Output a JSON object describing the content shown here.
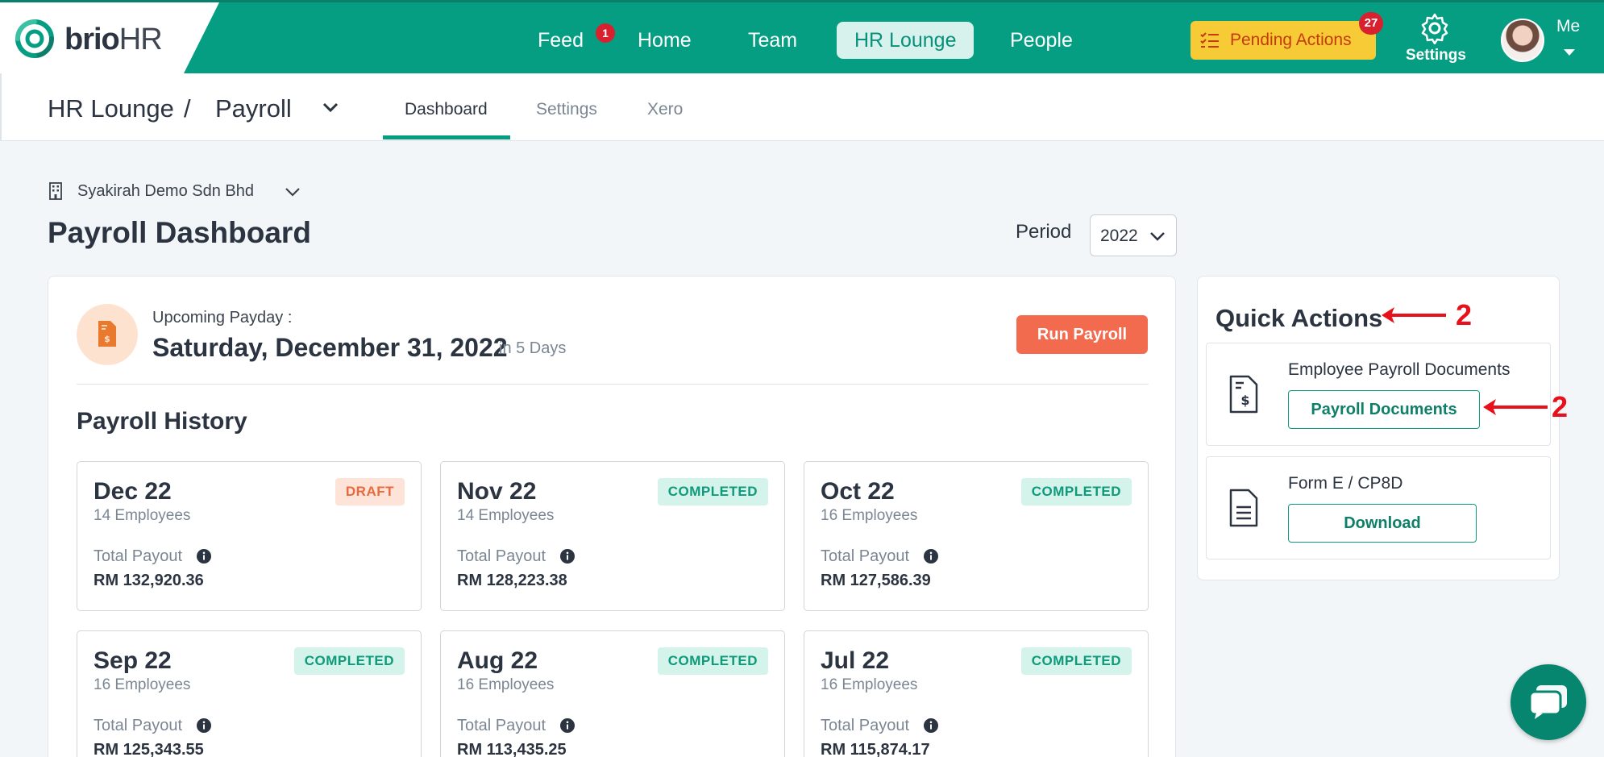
{
  "brand": {
    "name_bold": "brio",
    "name_light": "HR"
  },
  "nav": {
    "items": [
      {
        "label": "Feed",
        "badge": "1"
      },
      {
        "label": "Home"
      },
      {
        "label": "Team"
      },
      {
        "label": "HR Lounge",
        "active": true
      },
      {
        "label": "People"
      }
    ],
    "pending_actions": {
      "label": "Pending Actions",
      "badge": "27"
    },
    "settings_label": "Settings",
    "me_label": "Me"
  },
  "breadcrumb": {
    "root": "HR Lounge",
    "separator": "/",
    "current": "Payroll"
  },
  "subtabs": [
    {
      "label": "Dashboard",
      "active": true
    },
    {
      "label": "Settings"
    },
    {
      "label": "Xero"
    }
  ],
  "company": "Syakirah Demo Sdn Bhd",
  "page_title": "Payroll Dashboard",
  "period": {
    "label": "Period",
    "value": "2022"
  },
  "upcoming": {
    "label": "Upcoming Payday :",
    "date": "Saturday, December 31, 2022",
    "relative": "in 5 Days",
    "run_button": "Run Payroll"
  },
  "history": {
    "title": "Payroll History",
    "payout_label": "Total Payout",
    "cards": [
      {
        "month": "Dec 22",
        "employees": "14 Employees",
        "status": "DRAFT",
        "amount": "RM 132,920.36"
      },
      {
        "month": "Nov 22",
        "employees": "14 Employees",
        "status": "COMPLETED",
        "amount": "RM 128,223.38"
      },
      {
        "month": "Oct 22",
        "employees": "16 Employees",
        "status": "COMPLETED",
        "amount": "RM 127,586.39"
      },
      {
        "month": "Sep 22",
        "employees": "16 Employees",
        "status": "COMPLETED",
        "amount": "RM 125,343.55"
      },
      {
        "month": "Aug 22",
        "employees": "16 Employees",
        "status": "COMPLETED",
        "amount": "RM 113,435.25"
      },
      {
        "month": "Jul 22",
        "employees": "16 Employees",
        "status": "COMPLETED",
        "amount": "RM 115,874.17"
      }
    ]
  },
  "quick_actions": {
    "title": "Quick Actions",
    "items": [
      {
        "title": "Employee Payroll Documents",
        "button": "Payroll Documents"
      },
      {
        "title": "Form E / CP8D",
        "button": "Download"
      }
    ]
  },
  "annotations": {
    "title_marker": "2",
    "button_marker": "2"
  },
  "colors": {
    "brand_green": "#069e83",
    "pending_yellow": "#f6cb36",
    "run_payroll": "#f26b4e",
    "annotation_red": "#e8101a"
  }
}
